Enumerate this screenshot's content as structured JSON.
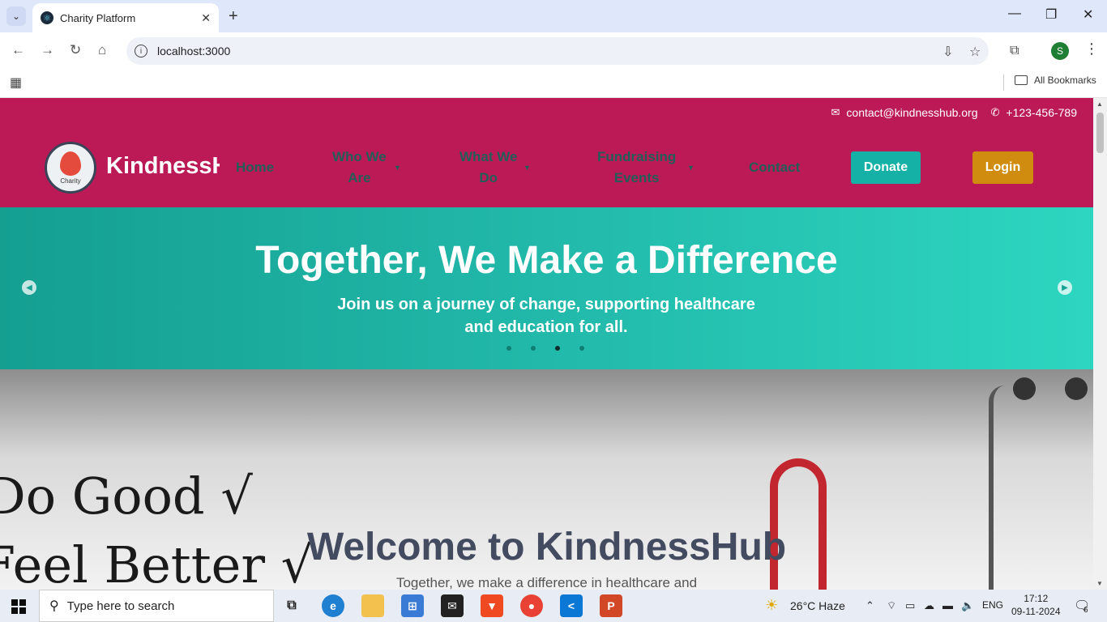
{
  "browser": {
    "tab_title": "Charity Platform",
    "url": "localhost:3000",
    "bookmarks_label": "All Bookmarks",
    "profile_initial": "S"
  },
  "site": {
    "contact_email": "contact@kindnesshub.org",
    "contact_phone": "+123-456-789",
    "logo_text": "Charity",
    "brand": "KindnessHub",
    "nav": {
      "home": "Home",
      "who_we_are_1": "Who We",
      "who_we_are_2": "Are",
      "what_we_do_1": "What We",
      "what_we_do_2": "Do",
      "fundraising_1": "Fundraising",
      "fundraising_2": "Events",
      "contact": "Contact"
    },
    "donate_label": "Donate",
    "login_label": "Login",
    "colors": {
      "header": "#bc1a57",
      "donate": "#16b1a6",
      "login": "#cf8c0f",
      "nav_text": "#235d58"
    }
  },
  "hero": {
    "title": "Together, We Make a Difference",
    "subtitle": "Join us on a journey of change, supporting healthcare and education for all.",
    "slide_count": 4,
    "active_slide": 3
  },
  "welcome": {
    "bg_text_1": "Do Good √",
    "bg_text_2": "Feel Better √",
    "title": "Welcome to KindnessHub",
    "subtitle": "Together, we make a difference in healthcare and"
  },
  "taskbar": {
    "search_placeholder": "Type here to search",
    "weather": "26°C  Haze",
    "language": "ENG",
    "time": "17:12",
    "date": "09-11-2024",
    "notifications": "6"
  }
}
